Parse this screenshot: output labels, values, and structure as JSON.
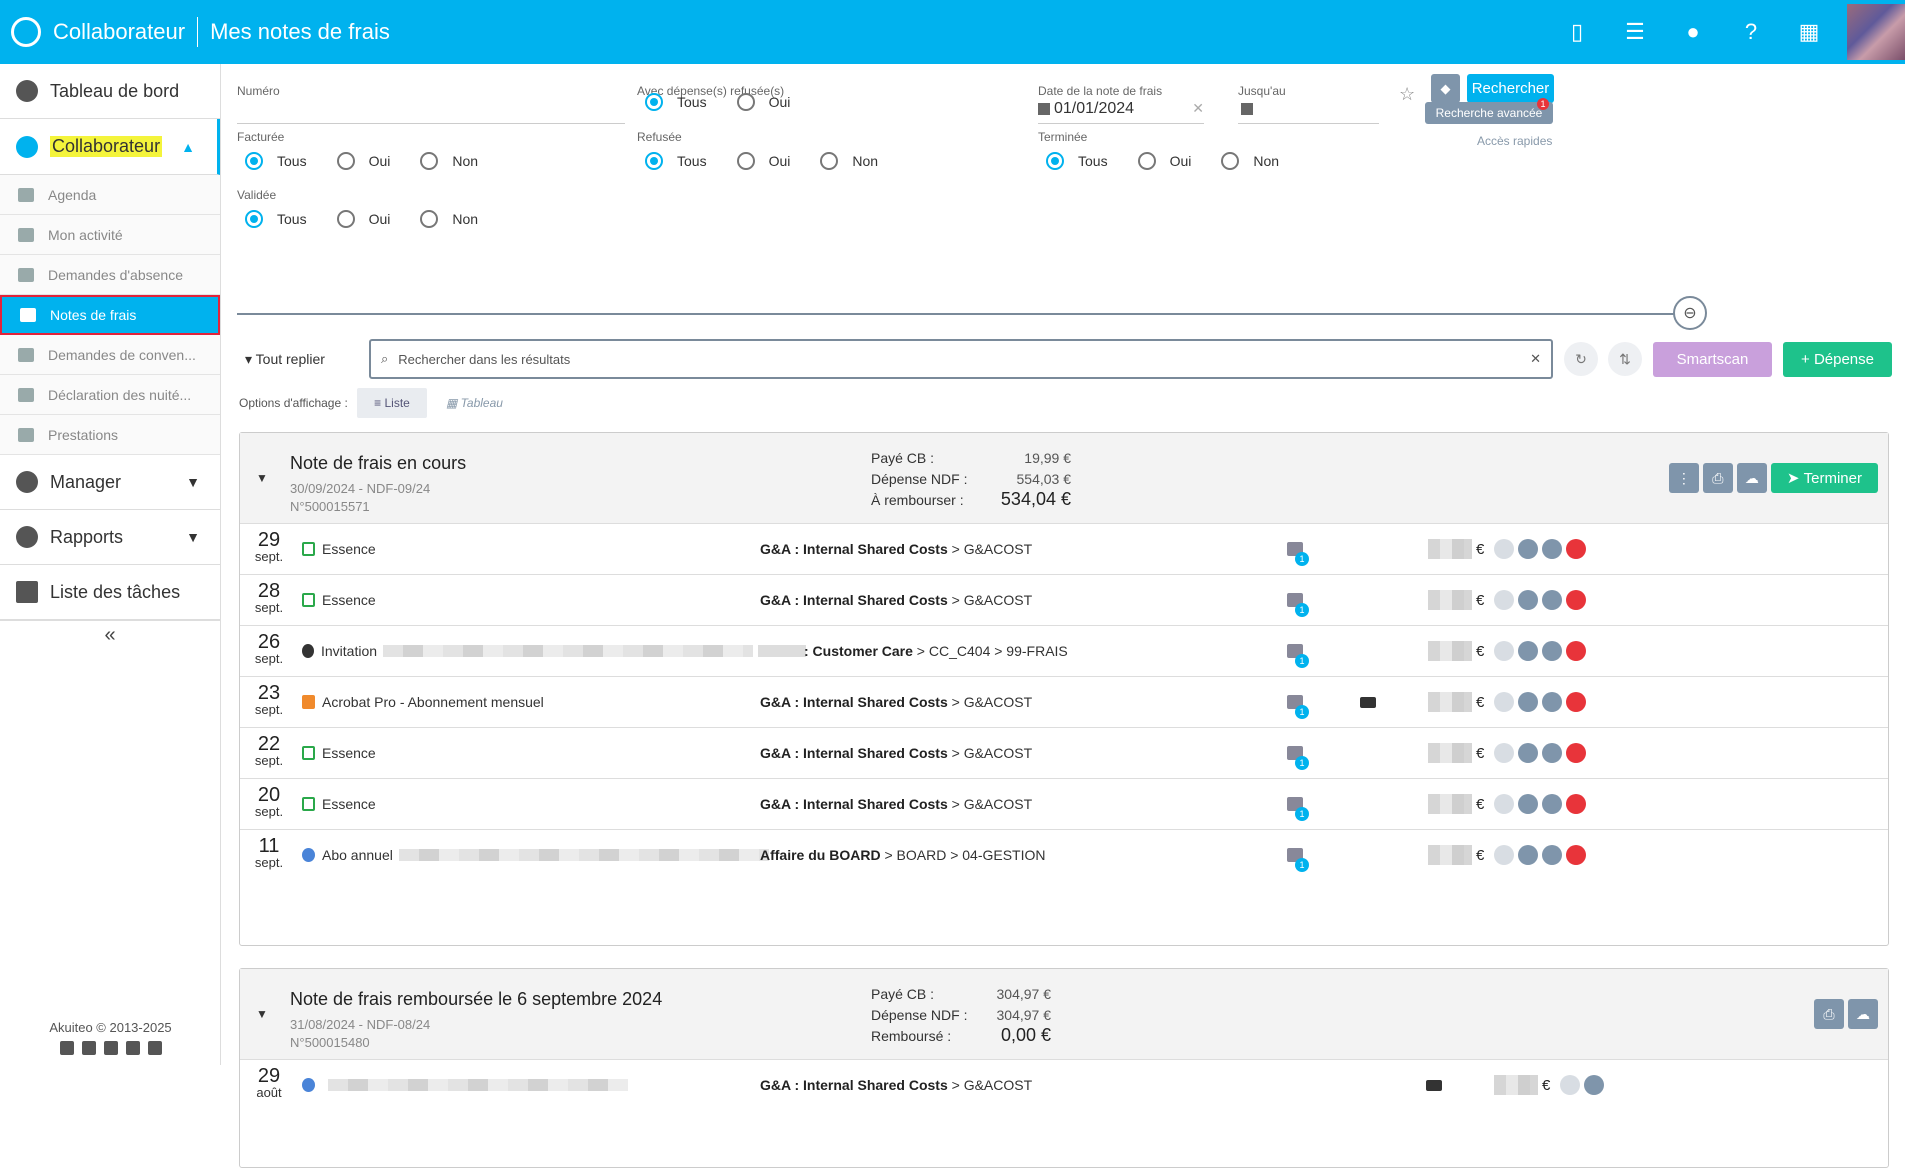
{
  "topbar": {
    "app_title": "Collaborateur",
    "page_title": "Mes notes de frais",
    "icons": [
      "mobile-icon",
      "sliders-icon",
      "lightbulb-icon",
      "help-icon",
      "apps-grid-icon"
    ]
  },
  "sidebar": {
    "dashboard": "Tableau de bord",
    "collab": "Collaborateur",
    "subitems": [
      "Agenda",
      "Mon activité",
      "Demandes d'absence",
      "Notes de frais",
      "Demandes de conven...",
      "Déclaration des nuité...",
      "Prestations"
    ],
    "manager": "Manager",
    "reports": "Rapports",
    "tasks": "Liste des tâches",
    "collapse": "«",
    "footer": "Akuiteo © 2013-2025"
  },
  "filters": {
    "numero_label": "Numéro",
    "refused_exp_label": "Avec dépense(s) refusée(s)",
    "date_label": "Date de la note de frais",
    "date_value": "01/01/2024",
    "until_label": "Jusqu'au",
    "billed_label": "Facturée",
    "refused_label": "Refusée",
    "done_label": "Terminée",
    "validated_label": "Validée",
    "opt_all": "Tous",
    "opt_yes": "Oui",
    "opt_no": "Non",
    "search_btn": "Rechercher",
    "adv_btn": "Recherche avancée",
    "quick_access": "Accès rapides"
  },
  "toolbar": {
    "collapse_all": "Tout replier",
    "search_placeholder": "Rechercher dans les résultats",
    "smartscan": "Smartscan",
    "add_expense": "Dépense",
    "display_label": "Options d'affichage :",
    "view_list": "Liste",
    "view_table": "Tableau"
  },
  "card1": {
    "title": "Note de frais en cours",
    "date_ref": "30/09/2024 - NDF-09/24",
    "number": "N°500015571",
    "paid_cb_label": "Payé CB :",
    "paid_cb": "19,99 €",
    "ndf_label": "Dépense NDF :",
    "ndf": "554,03 €",
    "refund_label": "À rembourser :",
    "refund": "534,04 €",
    "finish_btn": "Terminer",
    "rows": [
      {
        "day": "29",
        "month": "sept.",
        "cat": "Essence",
        "acct_b": "G&A : Internal Shared Costs",
        "acct": " > G&ACOST"
      },
      {
        "day": "28",
        "month": "sept.",
        "cat": "Essence",
        "acct_b": "G&A : Internal Shared Costs",
        "acct": " > G&ACOST"
      },
      {
        "day": "26",
        "month": "sept.",
        "cat": "Invitation",
        "acct_b": ": Customer Care",
        "acct": " > CC_C404 > 99-FRAIS"
      },
      {
        "day": "23",
        "month": "sept.",
        "cat": "Acrobat Pro - Abonnement mensuel",
        "acct_b": "G&A : Internal Shared Costs",
        "acct": " > G&ACOST"
      },
      {
        "day": "22",
        "month": "sept.",
        "cat": "Essence",
        "acct_b": "G&A : Internal Shared Costs",
        "acct": " > G&ACOST"
      },
      {
        "day": "20",
        "month": "sept.",
        "cat": "Essence",
        "acct_b": "G&A : Internal Shared Costs",
        "acct": " > G&ACOST"
      },
      {
        "day": "11",
        "month": "sept.",
        "cat": "Abo annuel",
        "acct_b": "Affaire du BOARD",
        "acct": " > BOARD > 04-GESTION"
      }
    ]
  },
  "card2": {
    "title": "Note de frais remboursée le 6 septembre 2024",
    "date_ref": "31/08/2024 - NDF-08/24",
    "number": "N°500015480",
    "paid_cb_label": "Payé CB :",
    "paid_cb": "304,97 €",
    "ndf_label": "Dépense NDF :",
    "ndf": "304,97 €",
    "refund_label": "Remboursé :",
    "refund": "0,00 €",
    "rows": [
      {
        "day": "29",
        "month": "août",
        "acct_b": "G&A : Internal Shared Costs",
        "acct": " > G&ACOST"
      }
    ]
  },
  "currency": "€",
  "badge_count": "1",
  "colors": {
    "primary": "#00b2ee",
    "green": "#1ec28b",
    "purple": "#c9a0dc",
    "gray": "#7f95ab",
    "red": "#e8343a"
  }
}
